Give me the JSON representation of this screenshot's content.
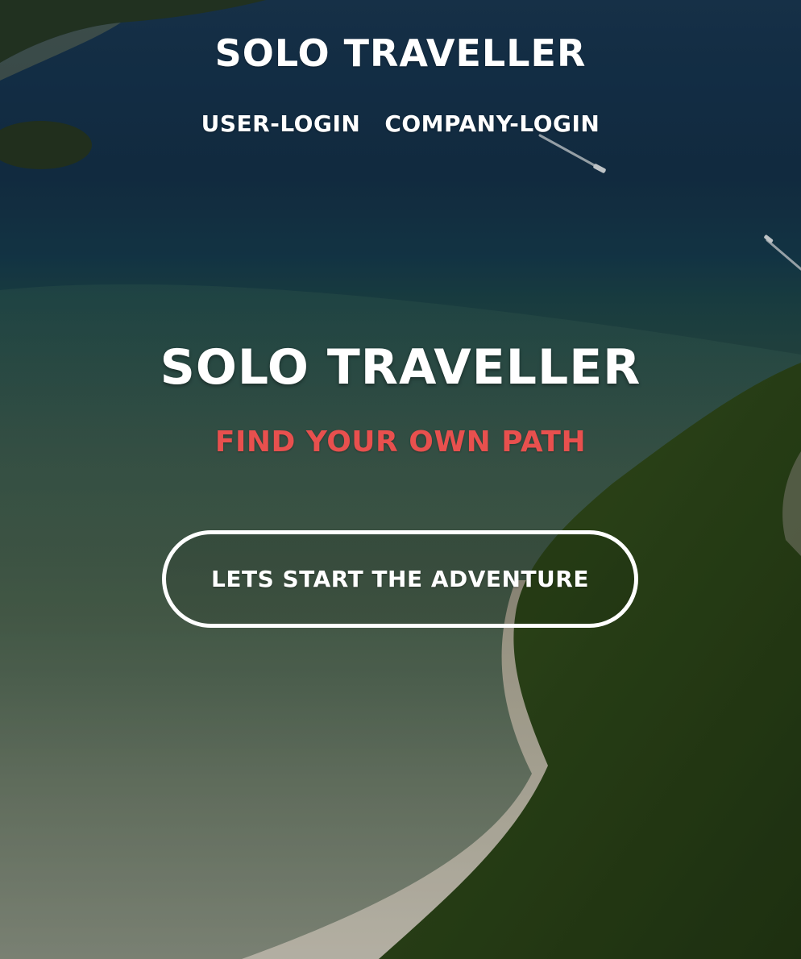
{
  "header": {
    "brand": "SOLO TRAVELLER",
    "nav": [
      {
        "label": "USER-LOGIN"
      },
      {
        "label": "COMPANY-LOGIN"
      }
    ]
  },
  "hero": {
    "title": "SOLO TRAVELLER",
    "subtitle": "FIND YOUR OWN PATH",
    "cta_label": "LETS START THE ADVENTURE"
  },
  "colors": {
    "subtitle_accent": "#e8504e",
    "text_primary": "#ffffff"
  }
}
